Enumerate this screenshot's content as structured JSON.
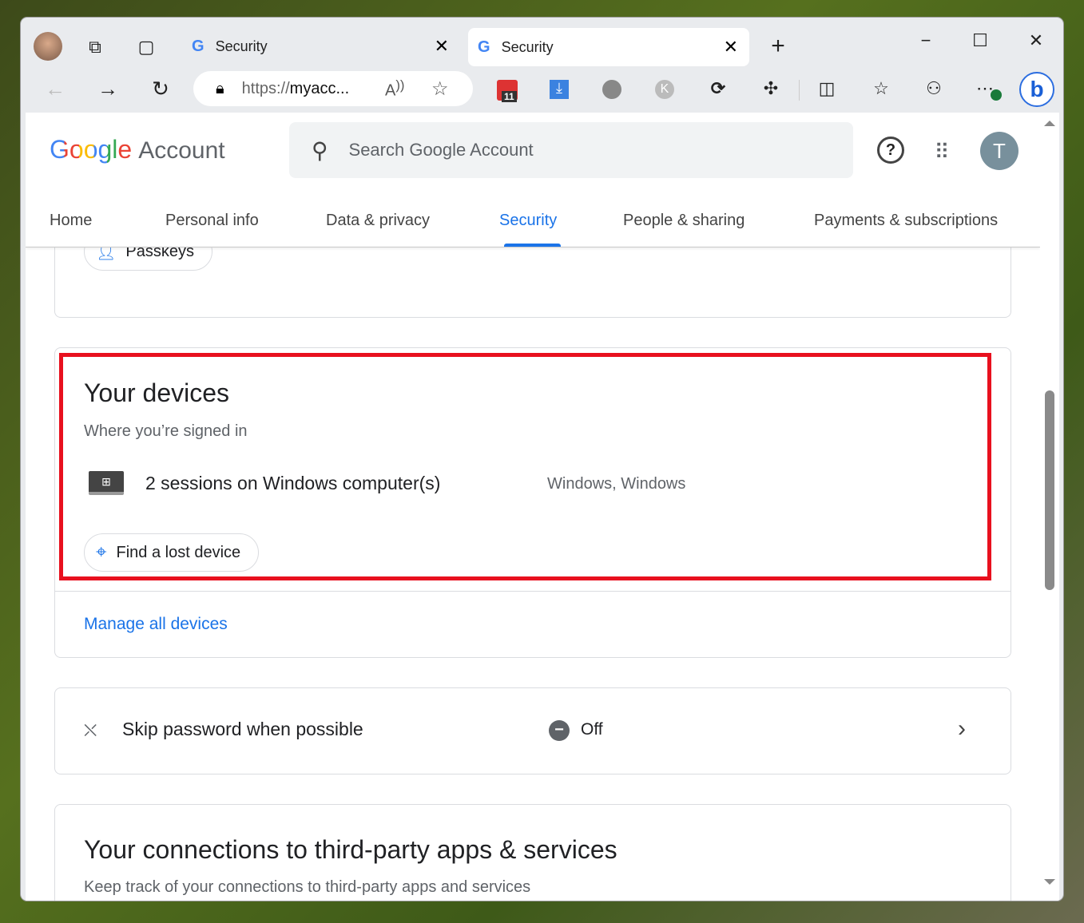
{
  "browser": {
    "tabs": [
      {
        "title": "Security",
        "active": false
      },
      {
        "title": "Security",
        "active": true
      }
    ],
    "address": {
      "prefix": "https://",
      "host": "myacc..."
    },
    "extension_badge": "11"
  },
  "header": {
    "logo_google": "Google",
    "logo_account": "Account",
    "search_placeholder": "Search Google Account",
    "avatar_letter": "T"
  },
  "nav": {
    "tabs": [
      "Home",
      "Personal info",
      "Data & privacy",
      "Security",
      "People & sharing",
      "Payments & subscriptions"
    ],
    "active": "Security"
  },
  "passkeys": {
    "label": "Passkeys"
  },
  "devices": {
    "title": "Your devices",
    "subtitle": "Where you’re signed in",
    "session": "2 sessions on Windows computer(s)",
    "platform": "Windows, Windows",
    "find_button": "Find a lost device",
    "manage_link": "Manage all devices"
  },
  "skip_password": {
    "label": "Skip password when possible",
    "status": "Off"
  },
  "third_party": {
    "title": "Your connections to third-party apps & services",
    "subtitle": "Keep track of your connections to third-party apps and services"
  },
  "colors": {
    "accent": "#1a73e8",
    "highlight": "#e8101e"
  }
}
